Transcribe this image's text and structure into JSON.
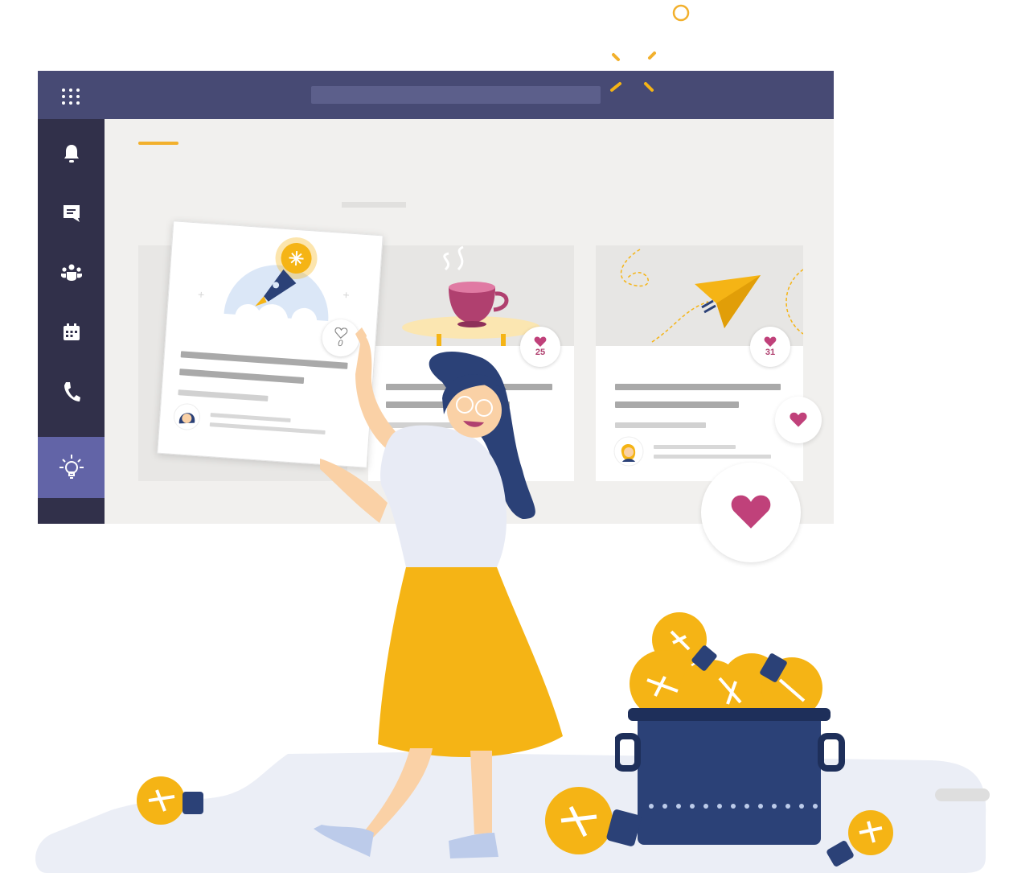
{
  "colors": {
    "titlebar": "#474a74",
    "rail": "#31304a",
    "rail_active": "#6264a7",
    "accent_yellow": "#f5b415",
    "heart": "#c0417a",
    "navy": "#2b4177"
  },
  "rail": {
    "items": [
      {
        "icon": "bell-icon"
      },
      {
        "icon": "chat-icon"
      },
      {
        "icon": "teams-icon"
      },
      {
        "icon": "calendar-icon"
      },
      {
        "icon": "phone-icon"
      },
      {
        "icon": "lightbulb-icon",
        "active": true
      }
    ]
  },
  "cards": [
    {
      "image": "rocket-icon",
      "likes": "0",
      "liked": false
    },
    {
      "image": "coffee-cup-icon",
      "likes": "25",
      "liked": true
    },
    {
      "image": "paper-plane-icon",
      "likes": "31",
      "liked": true
    }
  ]
}
